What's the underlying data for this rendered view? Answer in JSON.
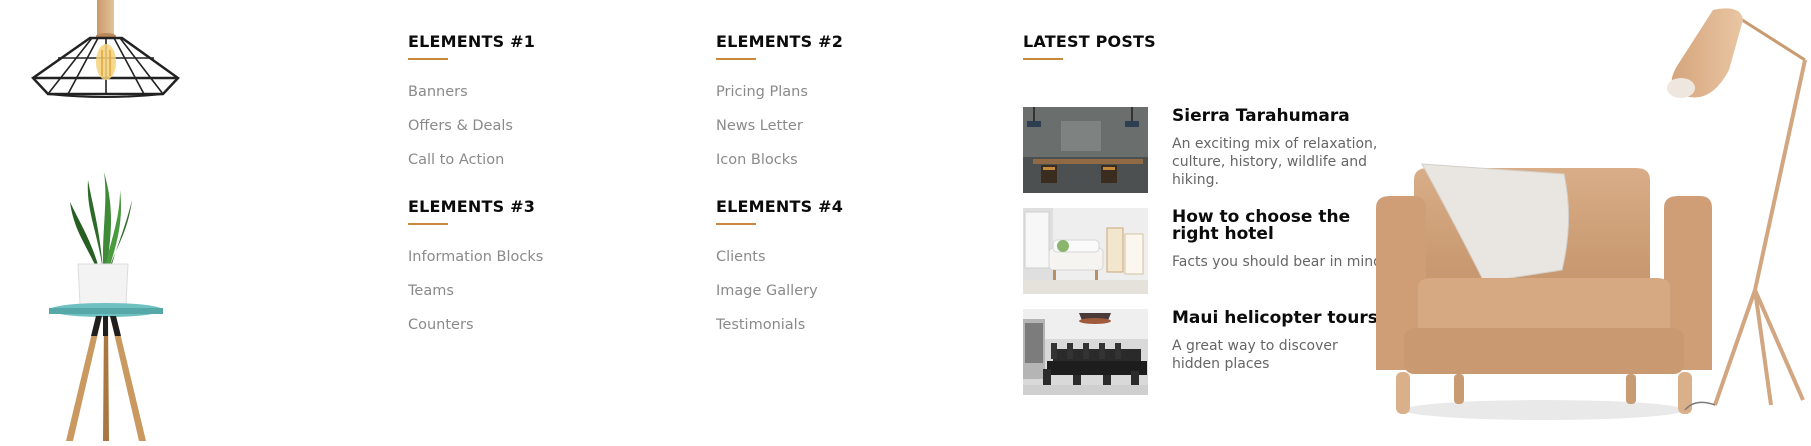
{
  "colors": {
    "accent": "#c8893a",
    "heading": "#0b0b0b",
    "link": "#8a8a8a",
    "excerpt": "#666666"
  },
  "columns": [
    {
      "title": "ELEMENTS #1",
      "items": [
        "Banners",
        "Offers & Deals",
        "Call to Action"
      ]
    },
    {
      "title": "ELEMENTS #2",
      "items": [
        "Pricing Plans",
        "News Letter",
        "Icon Blocks"
      ]
    },
    {
      "title": "ELEMENTS #3",
      "items": [
        "Information Blocks",
        "Teams",
        "Counters"
      ]
    },
    {
      "title": "ELEMENTS #4",
      "items": [
        "Clients",
        "Image Gallery",
        "Testimonials"
      ]
    }
  ],
  "latest_posts": {
    "title": "LATEST POSTS",
    "posts": [
      {
        "title": "Sierra Tarahumara",
        "excerpt": "An exciting mix of relaxation, culture, history, wildlife and hiking."
      },
      {
        "title": "How to choose the right hotel",
        "excerpt": "Facts you should bear in mind."
      },
      {
        "title": "Maui helicopter tours",
        "excerpt": "A great way to discover hidden places"
      }
    ]
  },
  "decor": {
    "left": [
      "pendant-lamp-icon",
      "potted-plant-icon",
      "side-table-icon"
    ],
    "right": [
      "armchair-icon",
      "floor-lamp-icon"
    ]
  }
}
